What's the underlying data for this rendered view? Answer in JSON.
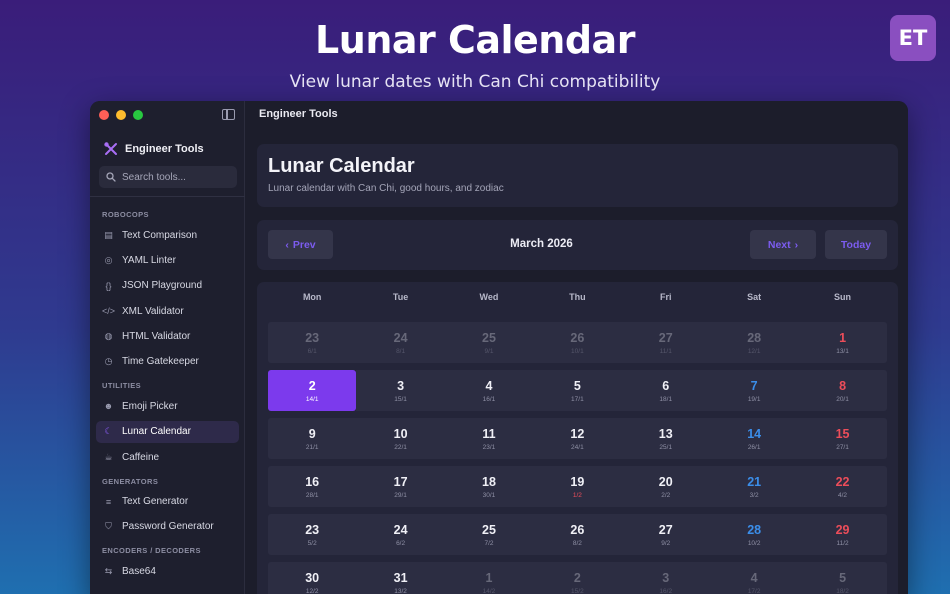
{
  "hero": {
    "title": "Lunar Calendar",
    "subtitle": "View lunar dates with Can Chi compatibility",
    "badge": "ET"
  },
  "sidebar": {
    "brand": "Engineer Tools",
    "search_placeholder": "Search tools...",
    "sections": [
      {
        "title": "ROBOCOPS",
        "items": [
          {
            "label": "Text Comparison",
            "icon": "document-icon"
          },
          {
            "label": "YAML Linter",
            "icon": "check-circle-icon"
          },
          {
            "label": "JSON Playground",
            "icon": "braces-icon"
          },
          {
            "label": "XML Validator",
            "icon": "code-icon"
          },
          {
            "label": "HTML Validator",
            "icon": "globe-icon"
          },
          {
            "label": "Time Gatekeeper",
            "icon": "clock-icon"
          }
        ]
      },
      {
        "title": "UTILITIES",
        "items": [
          {
            "label": "Emoji Picker",
            "icon": "smiley-icon"
          },
          {
            "label": "Lunar Calendar",
            "icon": "moon-icon",
            "active": true
          },
          {
            "label": "Caffeine",
            "icon": "cup-icon"
          }
        ]
      },
      {
        "title": "GENERATORS",
        "items": [
          {
            "label": "Text Generator",
            "icon": "lines-icon"
          },
          {
            "label": "Password Generator",
            "icon": "shield-icon"
          }
        ]
      },
      {
        "title": "ENCODERS / DECODERS",
        "items": [
          {
            "label": "Base64",
            "icon": "arrows-icon"
          }
        ]
      }
    ]
  },
  "main": {
    "topbar_title": "Engineer Tools",
    "page_title": "Lunar Calendar",
    "page_subtitle": "Lunar calendar with Can Chi, good hours, and zodiac",
    "prev_label": "Prev",
    "next_label": "Next",
    "today_label": "Today",
    "month_label": "March 2026"
  },
  "calendar": {
    "weekdays": [
      "Mon",
      "Tue",
      "Wed",
      "Thu",
      "Fri",
      "Sat",
      "Sun"
    ],
    "weeks": [
      [
        {
          "solar": "23",
          "lunar": "6/1",
          "muted": true
        },
        {
          "solar": "24",
          "lunar": "8/1",
          "muted": true
        },
        {
          "solar": "25",
          "lunar": "9/1",
          "muted": true
        },
        {
          "solar": "26",
          "lunar": "10/1",
          "muted": true
        },
        {
          "solar": "27",
          "lunar": "11/1",
          "muted": true
        },
        {
          "solar": "28",
          "lunar": "12/1",
          "muted": true
        },
        {
          "solar": "1",
          "lunar": "13/1"
        }
      ],
      [
        {
          "solar": "2",
          "lunar": "14/1",
          "today": true
        },
        {
          "solar": "3",
          "lunar": "15/1"
        },
        {
          "solar": "4",
          "lunar": "16/1"
        },
        {
          "solar": "5",
          "lunar": "17/1"
        },
        {
          "solar": "6",
          "lunar": "18/1"
        },
        {
          "solar": "7",
          "lunar": "19/1"
        },
        {
          "solar": "8",
          "lunar": "20/1"
        }
      ],
      [
        {
          "solar": "9",
          "lunar": "21/1"
        },
        {
          "solar": "10",
          "lunar": "22/1"
        },
        {
          "solar": "11",
          "lunar": "23/1"
        },
        {
          "solar": "12",
          "lunar": "24/1"
        },
        {
          "solar": "13",
          "lunar": "25/1"
        },
        {
          "solar": "14",
          "lunar": "26/1"
        },
        {
          "solar": "15",
          "lunar": "27/1"
        }
      ],
      [
        {
          "solar": "16",
          "lunar": "28/1"
        },
        {
          "solar": "17",
          "lunar": "29/1"
        },
        {
          "solar": "18",
          "lunar": "30/1"
        },
        {
          "solar": "19",
          "lunar": "1/2",
          "first_lunar": true
        },
        {
          "solar": "20",
          "lunar": "2/2"
        },
        {
          "solar": "21",
          "lunar": "3/2"
        },
        {
          "solar": "22",
          "lunar": "4/2"
        }
      ],
      [
        {
          "solar": "23",
          "lunar": "5/2"
        },
        {
          "solar": "24",
          "lunar": "6/2"
        },
        {
          "solar": "25",
          "lunar": "7/2"
        },
        {
          "solar": "26",
          "lunar": "8/2"
        },
        {
          "solar": "27",
          "lunar": "9/2"
        },
        {
          "solar": "28",
          "lunar": "10/2"
        },
        {
          "solar": "29",
          "lunar": "11/2"
        }
      ],
      [
        {
          "solar": "30",
          "lunar": "12/2"
        },
        {
          "solar": "31",
          "lunar": "13/2"
        },
        {
          "solar": "1",
          "lunar": "14/2",
          "muted": true
        },
        {
          "solar": "2",
          "lunar": "15/2",
          "muted": true
        },
        {
          "solar": "3",
          "lunar": "16/2",
          "muted": true
        },
        {
          "solar": "4",
          "lunar": "17/2",
          "muted": true
        },
        {
          "solar": "5",
          "lunar": "18/2",
          "muted": true
        }
      ]
    ]
  },
  "colors": {
    "accent": "#7c3aed",
    "saturday": "#3b8eea",
    "sunday": "#ec4d5a"
  }
}
